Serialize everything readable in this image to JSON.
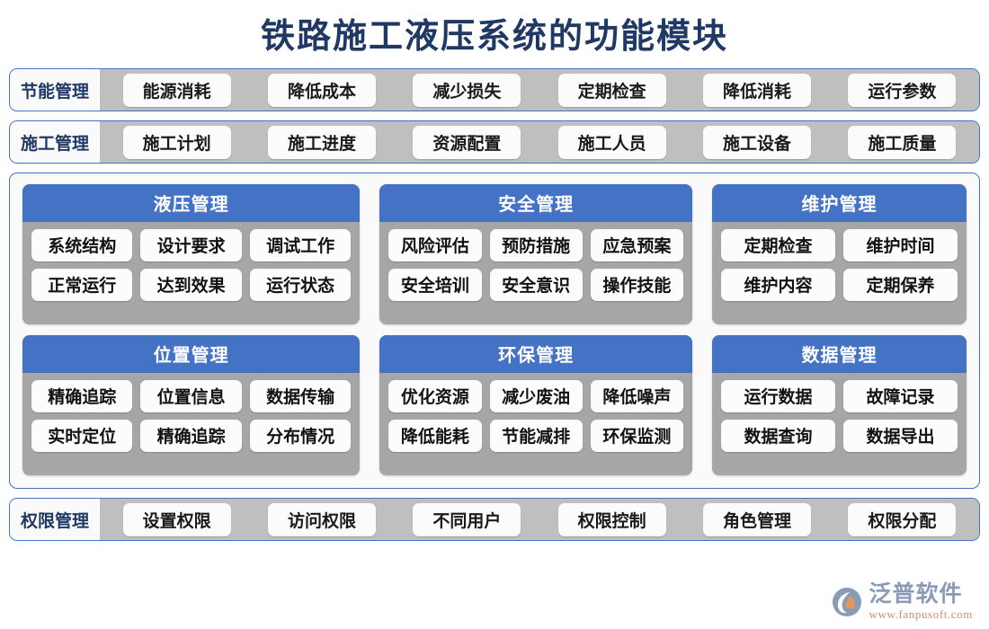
{
  "title": "铁路施工液压系统的功能模块",
  "colors": {
    "title_navy": "#1F3864",
    "accent_blue": "#4472C4",
    "card_gray": "#A6A6A6",
    "strip_gray": "#BFBFBF",
    "pill_white": "#FCFCFC",
    "logo_blue_gray": "#8A9BB5",
    "logo_orange": "#D98C6A"
  },
  "top_rows": [
    {
      "label": "节能管理",
      "items": [
        "能源消耗",
        "降低成本",
        "减少损失",
        "定期检查",
        "降低消耗",
        "运行参数"
      ]
    },
    {
      "label": "施工管理",
      "items": [
        "施工计划",
        "施工进度",
        "资源配置",
        "施工人员",
        "施工设备",
        "施工质量"
      ]
    }
  ],
  "cards": [
    {
      "header": "液压管理",
      "rows": [
        [
          "系统结构",
          "设计要求",
          "调试工作"
        ],
        [
          "正常运行",
          "达到效果",
          "运行状态"
        ]
      ]
    },
    {
      "header": "安全管理",
      "rows": [
        [
          "风险评估",
          "预防措施",
          "应急预案"
        ],
        [
          "安全培训",
          "安全意识",
          "操作技能"
        ]
      ]
    },
    {
      "header": "维护管理",
      "rows": [
        [
          "定期检查",
          "维护时间"
        ],
        [
          "维护内容",
          "定期保养"
        ]
      ]
    },
    {
      "header": "位置管理",
      "rows": [
        [
          "精确追踪",
          "位置信息",
          "数据传输"
        ],
        [
          "实时定位",
          "精确追踪",
          "分布情况"
        ]
      ]
    },
    {
      "header": "环保管理",
      "rows": [
        [
          "优化资源",
          "减少废油",
          "降低噪声"
        ],
        [
          "降低能耗",
          "节能减排",
          "环保监测"
        ]
      ]
    },
    {
      "header": "数据管理",
      "rows": [
        [
          "运行数据",
          "故障记录"
        ],
        [
          "数据查询",
          "数据导出"
        ]
      ]
    }
  ],
  "bottom_row": {
    "label": "权限管理",
    "items": [
      "设置权限",
      "访问权限",
      "不同用户",
      "权限控制",
      "角色管理",
      "权限分配"
    ]
  },
  "logo": {
    "name": "泛普软件",
    "url": "www.fanpusoft.com"
  }
}
